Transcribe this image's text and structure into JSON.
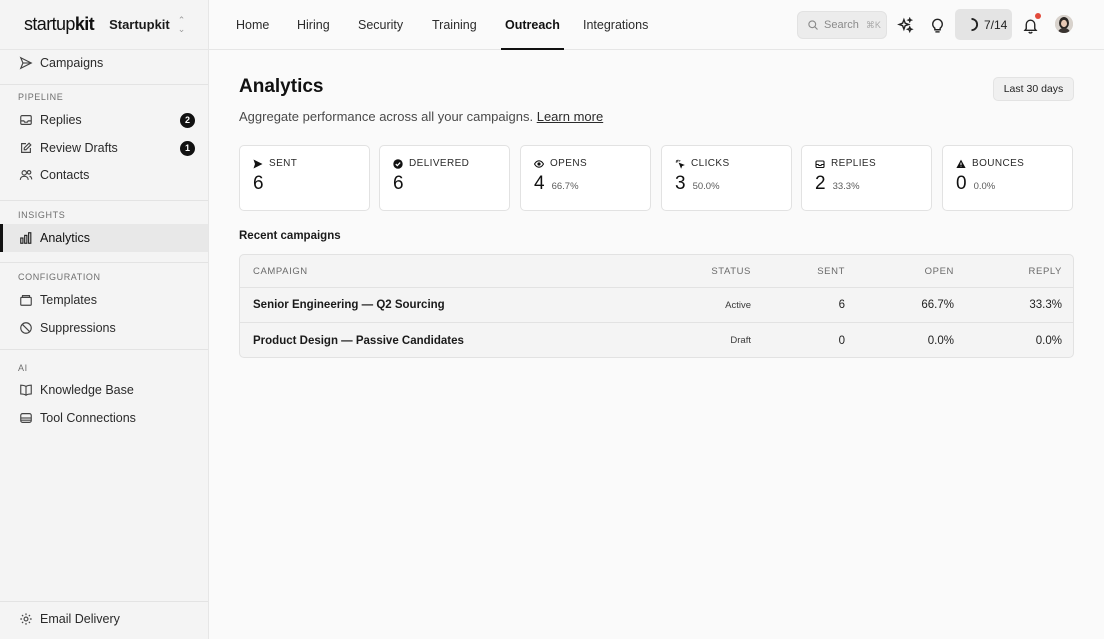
{
  "brand": {
    "logo_prefix": "startup",
    "logo_suffix": "kit",
    "workspace": "Startupkit"
  },
  "sidebar": {
    "campaigns": "Campaigns",
    "pipeline_label": "PIPELINE",
    "replies": "Replies",
    "replies_count": "2",
    "review_drafts": "Review Drafts",
    "review_drafts_count": "1",
    "contacts": "Contacts",
    "insights_label": "INSIGHTS",
    "analytics": "Analytics",
    "configuration_label": "CONFIGURATION",
    "templates": "Templates",
    "suppressions": "Suppressions",
    "ai_label": "AI",
    "knowledge_base": "Knowledge Base",
    "tool_connections": "Tool Connections",
    "email_delivery": "Email Delivery"
  },
  "topnav": {
    "tabs": [
      "Home",
      "Hiring",
      "Security",
      "Training",
      "Outreach",
      "Integrations"
    ],
    "active_tab": "Outreach",
    "search_placeholder": "Search",
    "search_shortcut": "⌘K",
    "progress": "7/14"
  },
  "page": {
    "title": "Analytics",
    "range_button": "Last 30 days",
    "subtitle": "Aggregate performance across all your campaigns.",
    "learn_more": "Learn more"
  },
  "stats": [
    {
      "label": "SENT",
      "value": "6",
      "pct": ""
    },
    {
      "label": "DELIVERED",
      "value": "6",
      "pct": ""
    },
    {
      "label": "OPENS",
      "value": "4",
      "pct": "66.7%"
    },
    {
      "label": "CLICKS",
      "value": "3",
      "pct": "50.0%"
    },
    {
      "label": "REPLIES",
      "value": "2",
      "pct": "33.3%"
    },
    {
      "label": "BOUNCES",
      "value": "0",
      "pct": "0.0%"
    }
  ],
  "campaigns": {
    "title": "Recent campaigns",
    "headers": {
      "campaign": "CAMPAIGN",
      "status": "STATUS",
      "sent": "SENT",
      "open": "OPEN",
      "reply": "REPLY"
    },
    "rows": [
      {
        "name": "Senior Engineering — Q2 Sourcing",
        "status": "Active",
        "sent": "6",
        "open": "66.7%",
        "reply": "33.3%"
      },
      {
        "name": "Product Design — Passive Candidates",
        "status": "Draft",
        "sent": "0",
        "open": "0.0%",
        "reply": "0.0%"
      }
    ]
  },
  "colors": {
    "accent": "#111111",
    "notification": "#e24a3b",
    "sidebar_bg": "#f4f4f4"
  }
}
